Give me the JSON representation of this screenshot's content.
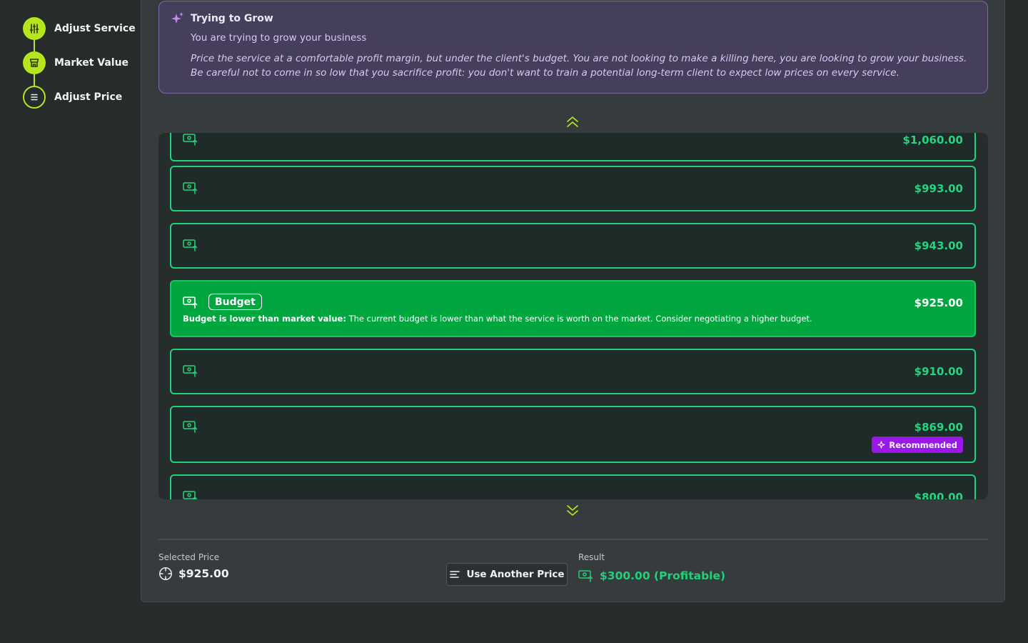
{
  "stepper": {
    "steps": [
      {
        "label": "Adjust Service",
        "icon": "sliders-icon",
        "state": "complete"
      },
      {
        "label": "Market Value",
        "icon": "storefront-icon",
        "state": "complete"
      },
      {
        "label": "Adjust Price",
        "icon": "list-icon",
        "state": "current"
      }
    ]
  },
  "strategy": {
    "icon": "sparkles-icon",
    "title": "Trying to Grow",
    "subtitle": "You are trying to grow your business",
    "body": "Price the service at a comfortable profit margin, but under the client's budget. You are not looking to make a killing here, you are looking to grow your business. Be careful not to come in so low that you sacrifice profit: you don't want to train a potential long-term client to expect low prices on every service."
  },
  "price_list": {
    "scroll_up_icon": "double-chevron-up-icon",
    "scroll_down_icon": "double-chevron-down-icon",
    "items": [
      {
        "price": "$1,060.00"
      },
      {
        "price": "$993.00"
      },
      {
        "price": "$943.00"
      },
      {
        "price": "$925.00",
        "tag": "Budget",
        "note_bold": "Budget is lower than market value:",
        "note": " The current budget is lower than what the service is worth on the market. Consider negotiating a higher budget.",
        "selected": true
      },
      {
        "price": "$910.00"
      },
      {
        "price": "$869.00",
        "badge": "Recommended"
      },
      {
        "price": "$800.00"
      }
    ]
  },
  "footer": {
    "selected_label": "Selected Price",
    "selected_value": "$925.00",
    "another_button": "Use Another Price",
    "result_label": "Result",
    "result_value": "$300.00 (Profitable)"
  },
  "colors": {
    "accent_lime": "#b5e61d",
    "price_green": "#23d67f",
    "selected_green": "#00a63e",
    "recommended_purple": "#9b19e8",
    "strategy_bg": "#453f5c"
  }
}
